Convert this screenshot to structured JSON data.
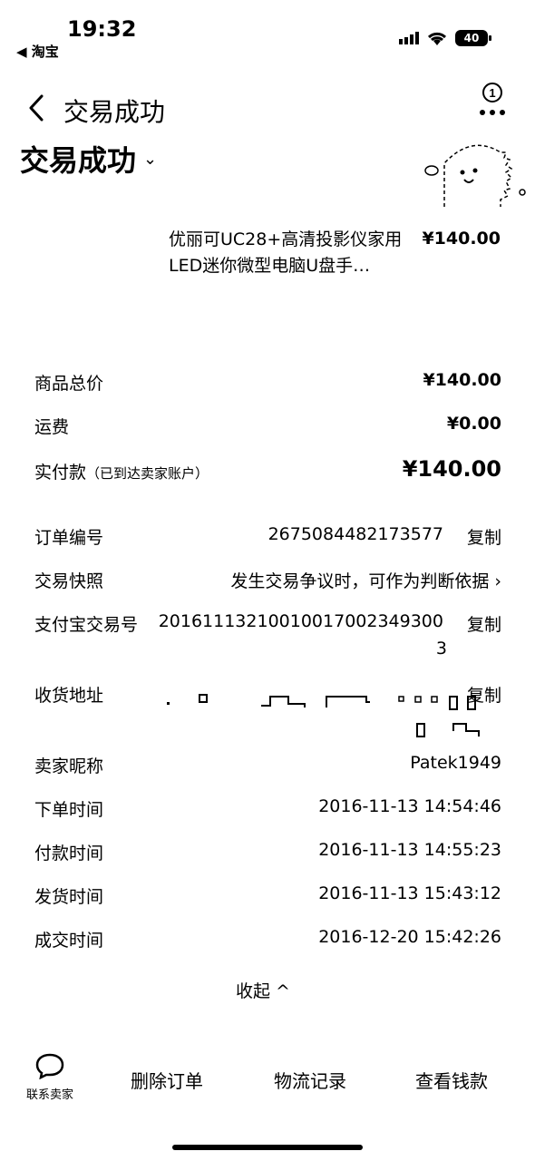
{
  "status_bar": {
    "time": "19:32",
    "back_app": "◀ 淘宝",
    "battery": "40"
  },
  "nav": {
    "title": "交易成功"
  },
  "order_status": {
    "title": "交易成功",
    "chevron": "⌄"
  },
  "product": {
    "name": "优丽可UC28+高清投影仪家用LED迷你微型电脑U盘手…",
    "price": "¥140.00"
  },
  "summary": {
    "goods_total_label": "商品总价",
    "goods_total": "¥140.00",
    "shipping_label": "运费",
    "shipping": "¥0.00",
    "paid_label": "实付款",
    "paid_note": "（已到达卖家账户）",
    "paid": "¥140.00"
  },
  "details": {
    "order_no_label": "订单编号",
    "order_no": "2675084482173577",
    "copy": "复制",
    "snapshot_label": "交易快照",
    "snapshot_value": "发生交易争议时，可作为判断依据 ›",
    "alipay_label": "支付宝交易号",
    "alipay_no": "20161113210010017002349300",
    "alipay_no_tail": "3",
    "address_label": "收货地址",
    "seller_label": "卖家昵称",
    "seller": "Patek1949",
    "order_time_label": "下单时间",
    "order_time": "2016-11-13 14:54:46",
    "pay_time_label": "付款时间",
    "pay_time": "2016-11-13 14:55:23",
    "ship_time_label": "发货时间",
    "ship_time": "2016-11-13 15:43:12",
    "deal_time_label": "成交时间",
    "deal_time": "2016-12-20 15:42:26"
  },
  "collapse": "收起 ^",
  "bottom": {
    "contact": "联系卖家",
    "delete": "删除订单",
    "logistics": "物流记录",
    "view_money": "查看钱款"
  }
}
